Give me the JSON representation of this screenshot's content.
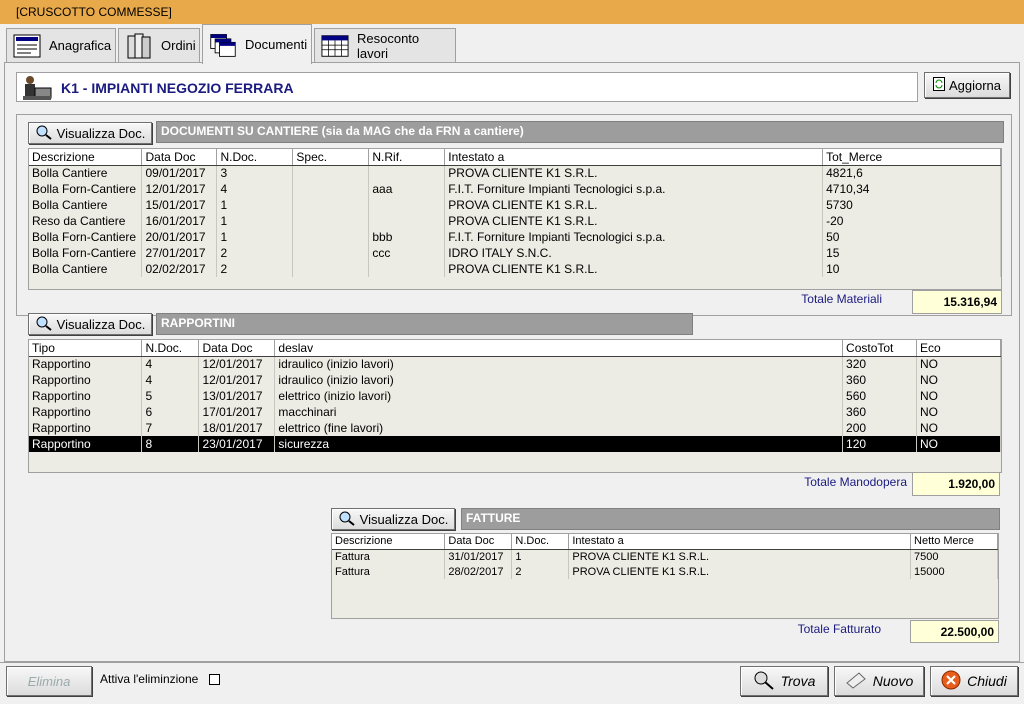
{
  "window": {
    "title": "[CRUSCOTTO COMMESSE]"
  },
  "tabs": [
    {
      "label": "Anagrafica",
      "icon": "form-icon"
    },
    {
      "label": "Ordini",
      "icon": "binders-icon"
    },
    {
      "label": "Documenti",
      "icon": "documents-icon",
      "active": true
    },
    {
      "label": "Resoconto lavori",
      "icon": "calendar-icon"
    }
  ],
  "header": {
    "title": "K1 - IMPIANTI NEGOZIO FERRARA",
    "refresh_label": "Aggiorna"
  },
  "documenti": {
    "view_label": "Visualizza Doc.",
    "section_title": "DOCUMENTI  SU CANTIERE (sia da MAG che da FRN a cantiere)",
    "columns": [
      "Descrizione",
      "Data Doc",
      "N.Doc.",
      "Spec.",
      "N.Rif.",
      "Intestato a",
      "Tot_Merce"
    ],
    "rows": [
      [
        "Bolla Cantiere",
        "09/01/2017",
        "3",
        "",
        "",
        "PROVA CLIENTE K1 S.R.L.",
        "4821,6"
      ],
      [
        "Bolla Forn-Cantiere",
        "12/01/2017",
        "4",
        "",
        "aaa",
        "F.I.T. Forniture Impianti Tecnologici s.p.a.",
        "4710,34"
      ],
      [
        "Bolla Cantiere",
        "15/01/2017",
        "1",
        "",
        "",
        "PROVA CLIENTE K1 S.R.L.",
        "5730"
      ],
      [
        "Reso da Cantiere",
        "16/01/2017",
        "1",
        "",
        "",
        "PROVA CLIENTE K1 S.R.L.",
        "-20"
      ],
      [
        "Bolla Forn-Cantiere",
        "20/01/2017",
        "1",
        "",
        "bbb",
        "F.I.T. Forniture Impianti Tecnologici s.p.a.",
        "50"
      ],
      [
        "Bolla Forn-Cantiere",
        "27/01/2017",
        "2",
        "",
        "ccc",
        "IDRO ITALY S.N.C.",
        "15"
      ],
      [
        "Bolla Cantiere",
        "02/02/2017",
        "2",
        "",
        "",
        "PROVA CLIENTE K1 S.R.L.",
        "10"
      ]
    ],
    "total_label": "Totale Materiali",
    "total_value": "15.316,94"
  },
  "rapportini": {
    "view_label": "Visualizza Doc.",
    "section_title": "RAPPORTINI",
    "columns": [
      "Tipo",
      "N.Doc.",
      "Data Doc",
      "deslav",
      "CostoTot",
      "Eco"
    ],
    "rows": [
      [
        "Rapportino",
        "4",
        "12/01/2017",
        "idraulico (inizio lavori)",
        "320",
        "NO"
      ],
      [
        "Rapportino",
        "4",
        "12/01/2017",
        "idraulico (inizio lavori)",
        "360",
        "NO"
      ],
      [
        "Rapportino",
        "5",
        "13/01/2017",
        "elettrico (inizio lavori)",
        "560",
        "NO"
      ],
      [
        "Rapportino",
        "6",
        "17/01/2017",
        "macchinari",
        "360",
        "NO"
      ],
      [
        "Rapportino",
        "7",
        "18/01/2017",
        "elettrico (fine lavori)",
        "200",
        "NO"
      ],
      [
        "Rapportino",
        "8",
        "23/01/2017",
        "sicurezza",
        "120",
        "NO"
      ]
    ],
    "selected_row": 5,
    "total_label": "Totale Manodopera",
    "total_value": "1.920,00"
  },
  "fatture": {
    "view_label": "Visualizza Doc.",
    "section_title": "FATTURE",
    "columns": [
      "Descrizione",
      "Data Doc",
      "N.Doc.",
      "Intestato a",
      "Netto Merce"
    ],
    "rows": [
      [
        "Fattura",
        "31/01/2017",
        "1",
        "PROVA CLIENTE K1 S.R.L.",
        "7500"
      ],
      [
        "Fattura",
        "28/02/2017",
        "2",
        "PROVA CLIENTE K1 S.R.L.",
        "15000"
      ]
    ],
    "total_label": "Totale Fatturato",
    "total_value": "22.500,00"
  },
  "footer": {
    "delete_label": "Elimina",
    "enable_delete_label": "Attiva l'eliminzione",
    "find_label": "Trova",
    "new_label": "Nuovo",
    "close_label": "Chiudi"
  }
}
